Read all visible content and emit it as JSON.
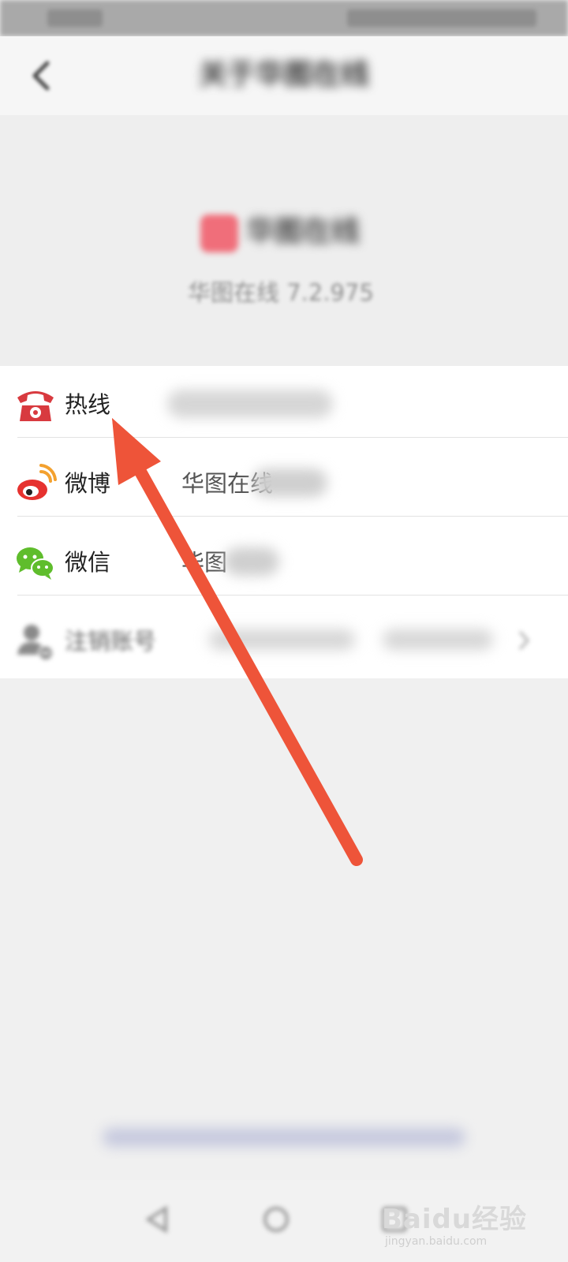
{
  "header": {
    "title": "关于华图在线",
    "back_icon": "back-chevron-icon"
  },
  "about": {
    "app_name": "华图在线",
    "app_version": "华图在线 7.2.975"
  },
  "list": [
    {
      "label": "热线",
      "icon": "telephone-icon",
      "value": ""
    },
    {
      "label": "微博",
      "icon": "weibo-icon",
      "value": "华图在线"
    },
    {
      "label": "微信",
      "icon": "wechat-icon",
      "value": "华图"
    },
    {
      "label": "注销账号",
      "icon": "user-remove-icon",
      "value": ""
    }
  ],
  "colors": {
    "accent_red": "#e8403a",
    "wechat_green": "#5fbd2c",
    "arrow": "#ee5439"
  },
  "footer": {
    "link_text": ""
  },
  "watermark": {
    "logo_text": "Baidu经验",
    "url": "jingyan.baidu.com"
  }
}
